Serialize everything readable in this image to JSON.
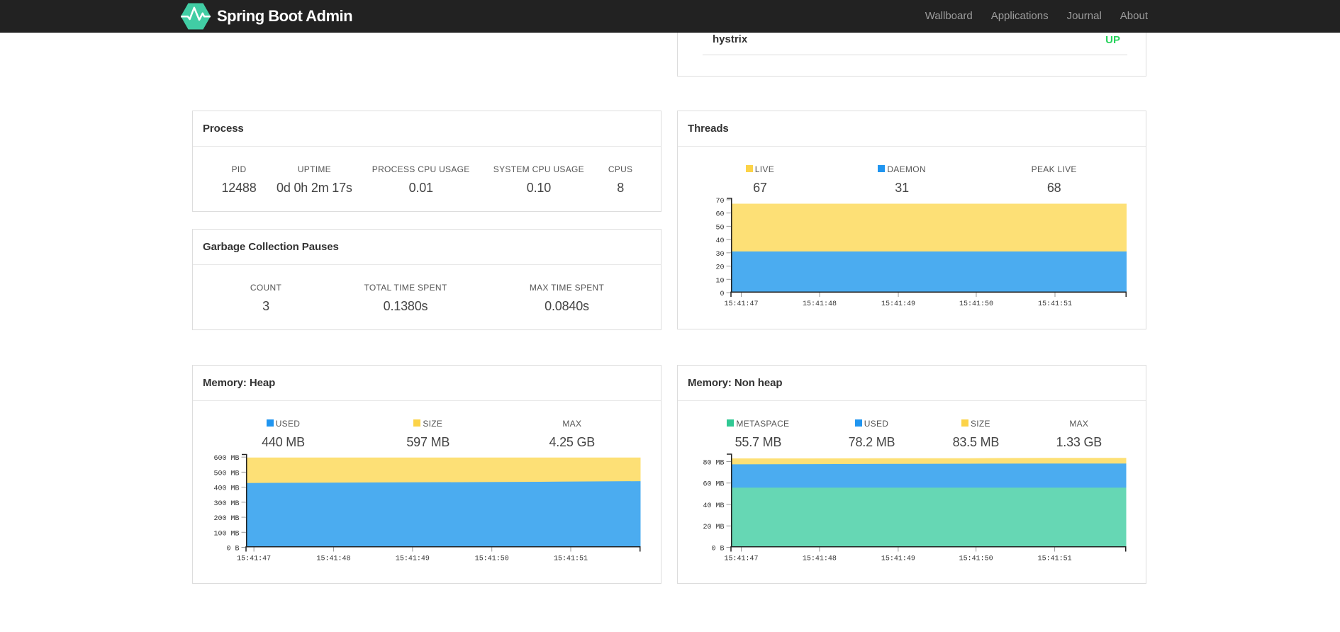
{
  "navbar": {
    "brand": "Spring Boot Admin",
    "links": [
      {
        "label": "Wallboard"
      },
      {
        "label": "Applications"
      },
      {
        "label": "Journal"
      },
      {
        "label": "About"
      }
    ]
  },
  "application": {
    "name": "hystrix",
    "status": "UP",
    "status_color": "#26d35c"
  },
  "process": {
    "title": "Process",
    "metrics": [
      {
        "label": "PID",
        "value": "12488"
      },
      {
        "label": "UPTIME",
        "value": "0d 0h 2m 17s"
      },
      {
        "label": "PROCESS CPU USAGE",
        "value": "0.01"
      },
      {
        "label": "SYSTEM CPU USAGE",
        "value": "0.10"
      },
      {
        "label": "CPUS",
        "value": "8"
      }
    ]
  },
  "gc": {
    "title": "Garbage Collection Pauses",
    "metrics": [
      {
        "label": "COUNT",
        "value": "3"
      },
      {
        "label": "TOTAL TIME SPENT",
        "value": "0.1380s"
      },
      {
        "label": "MAX TIME SPENT",
        "value": "0.0840s"
      }
    ]
  },
  "threads": {
    "title": "Threads",
    "metrics": [
      {
        "label": "LIVE",
        "value": "67",
        "color": "#fcd348"
      },
      {
        "label": "DAEMON",
        "value": "31",
        "color": "#2095f0"
      },
      {
        "label": "PEAK LIVE",
        "value": "68"
      }
    ]
  },
  "heap": {
    "title": "Memory: Heap",
    "metrics": [
      {
        "label": "USED",
        "value": "440 MB",
        "color": "#2095f0"
      },
      {
        "label": "SIZE",
        "value": "597 MB",
        "color": "#fcd348"
      },
      {
        "label": "MAX",
        "value": "4.25 GB"
      }
    ]
  },
  "nonheap": {
    "title": "Memory: Non heap",
    "metrics": [
      {
        "label": "METASPACE",
        "value": "55.7 MB",
        "color": "#30c893"
      },
      {
        "label": "USED",
        "value": "78.2 MB",
        "color": "#2095f0"
      },
      {
        "label": "SIZE",
        "value": "83.5 MB",
        "color": "#fcd348"
      },
      {
        "label": "MAX",
        "value": "1.33 GB"
      }
    ]
  },
  "chart_data": [
    {
      "id": "threads",
      "type": "area",
      "title": "Threads",
      "x": [
        "15:41:47",
        "15:41:48",
        "15:41:49",
        "15:41:50",
        "15:41:51"
      ],
      "ylim": [
        0,
        71.5
      ],
      "yticks": [
        {
          "v": 0,
          "label": "0"
        },
        {
          "v": 10,
          "label": "10"
        },
        {
          "v": 20,
          "label": "20"
        },
        {
          "v": 30,
          "label": "30"
        },
        {
          "v": 40,
          "label": "40"
        },
        {
          "v": 50,
          "label": "50"
        },
        {
          "v": 60,
          "label": "60"
        },
        {
          "v": 70,
          "label": "70"
        }
      ],
      "legend_position": "top",
      "grid": false,
      "series": [
        {
          "name": "LIVE",
          "color": "#fde076",
          "values": [
            67,
            67,
            67,
            67,
            67,
            67
          ]
        },
        {
          "name": "DAEMON",
          "color": "#4bacf0",
          "values": [
            31,
            31,
            31,
            31,
            31,
            31
          ]
        }
      ]
    },
    {
      "id": "heap",
      "type": "area",
      "title": "Memory: Heap",
      "x": [
        "15:41:47",
        "15:41:48",
        "15:41:49",
        "15:41:50",
        "15:41:51"
      ],
      "ylim": [
        0,
        621
      ],
      "yticks": [
        {
          "v": 0,
          "label": "0 B"
        },
        {
          "v": 100,
          "label": "100 MB"
        },
        {
          "v": 200,
          "label": "200 MB"
        },
        {
          "v": 300,
          "label": "300 MB"
        },
        {
          "v": 400,
          "label": "400 MB"
        },
        {
          "v": 500,
          "label": "500 MB"
        },
        {
          "v": 600,
          "label": "600 MB"
        }
      ],
      "legend_position": "top",
      "grid": false,
      "series": [
        {
          "name": "SIZE",
          "color": "#fde076",
          "values": [
            597,
            597,
            597,
            597,
            597,
            597
          ]
        },
        {
          "name": "USED",
          "color": "#4bacf0",
          "values": [
            428,
            430,
            432,
            434,
            437,
            440
          ]
        }
      ]
    },
    {
      "id": "nonheap",
      "type": "area",
      "title": "Memory: Non heap",
      "x": [
        "15:41:47",
        "15:41:48",
        "15:41:49",
        "15:41:50",
        "15:41:51"
      ],
      "ylim": [
        0,
        87.4
      ],
      "yticks": [
        {
          "v": 0,
          "label": "0 B"
        },
        {
          "v": 20,
          "label": "20 MB"
        },
        {
          "v": 40,
          "label": "40 MB"
        },
        {
          "v": 60,
          "label": "60 MB"
        },
        {
          "v": 80,
          "label": "80 MB"
        }
      ],
      "legend_position": "top",
      "grid": false,
      "series": [
        {
          "name": "SIZE",
          "color": "#fde076",
          "values": [
            83.0,
            83.0,
            83.2,
            83.2,
            83.5,
            83.5
          ]
        },
        {
          "name": "USED",
          "color": "#4bacf0",
          "values": [
            77.4,
            77.6,
            77.8,
            78.0,
            78.2,
            78.2
          ]
        },
        {
          "name": "METASPACE",
          "color": "#66d7b4",
          "values": [
            55.7,
            55.7,
            55.7,
            55.7,
            55.7,
            55.7
          ]
        }
      ]
    }
  ]
}
